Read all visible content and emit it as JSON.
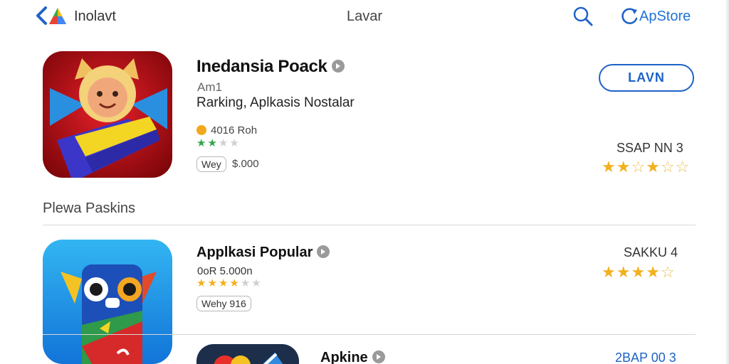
{
  "header": {
    "brand": "Inolavt",
    "title": "Lavar",
    "store": "ApStore"
  },
  "featured": {
    "title": "Inedansia Poack",
    "subtitle": "Am1",
    "description": "Rarking, Aplkasis Nostalar",
    "meta": "4016 Roh",
    "chip": "Wey",
    "price": "$.000",
    "button": "LAVN",
    "rank": "SSAP NN 3",
    "rating": 3
  },
  "section": {
    "title": "Plewa Paskins"
  },
  "list": [
    {
      "title": "Applkasi Popular",
      "meta": "0oR 5.000n",
      "chip": "Wehy 916",
      "rank": "SAKKU 4",
      "rating": 3.5
    },
    {
      "title": "Apkine",
      "rank": "2BAP 00 3"
    }
  ],
  "colors": {
    "accent": "#1f63c8",
    "star": "#f2b01e",
    "star_green": "#31a54a"
  }
}
